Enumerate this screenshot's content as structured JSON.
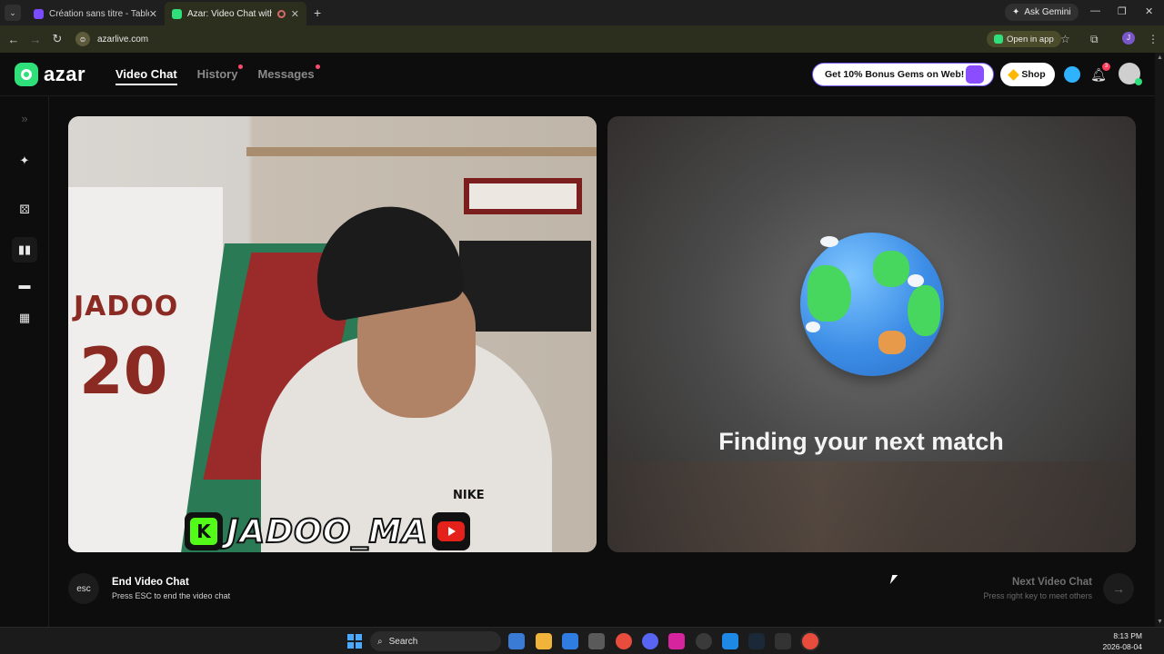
{
  "browser": {
    "tabs": [
      {
        "title": "Création sans titre - Tableau bla",
        "active": false,
        "favicon_color": "#7b4cff"
      },
      {
        "title": "Azar: Video Chat with New",
        "active": true,
        "favicon_color": "#2fe07a"
      }
    ],
    "new_tab_label": "+",
    "ask_gemini": "Ask Gemini",
    "url": "azarlive.com",
    "open_in_app": "Open in app",
    "profile_initial": "J"
  },
  "app": {
    "logo_text": "azar",
    "nav": [
      {
        "label": "Video Chat",
        "active": true,
        "dot": false
      },
      {
        "label": "History",
        "active": false,
        "dot": true
      },
      {
        "label": "Messages",
        "active": false,
        "dot": true
      }
    ],
    "promo_label": "Get 10% Bonus Gems on Web!",
    "shop_label": "Shop",
    "notification_count": "3"
  },
  "sidebar": [
    {
      "icon": "expand-icon",
      "glyph": "»"
    },
    {
      "icon": "magic-wand-icon",
      "glyph": "✦"
    },
    {
      "icon": "dice-icon",
      "glyph": "⚄"
    },
    {
      "icon": "layout-side-by-side-icon",
      "glyph": "▮▮"
    },
    {
      "icon": "layout-stacked-icon",
      "glyph": "▬"
    },
    {
      "icon": "layout-grid-icon",
      "glyph": "▦"
    }
  ],
  "local_video": {
    "overlay_handle": "JADOO_MA",
    "jersey_text": "JADOO",
    "jersey_number": "20",
    "kick_letter": "K",
    "brand_text": "NIKE"
  },
  "remote_video": {
    "status_text": "Finding your next match"
  },
  "controls": {
    "esc_key": "esc",
    "end_title": "End Video Chat",
    "end_subtitle": "Press ESC to end the video chat",
    "next_title": "Next Video Chat",
    "next_subtitle": "Press right key to meet others",
    "next_arrow": "→"
  },
  "taskbar": {
    "search_label": "Search",
    "time": "8:13 PM",
    "date": "2026-08-04"
  },
  "colors": {
    "accent": "#2fe07a",
    "notification": "#ff3b5c",
    "promo_border": "#7a5bff"
  }
}
